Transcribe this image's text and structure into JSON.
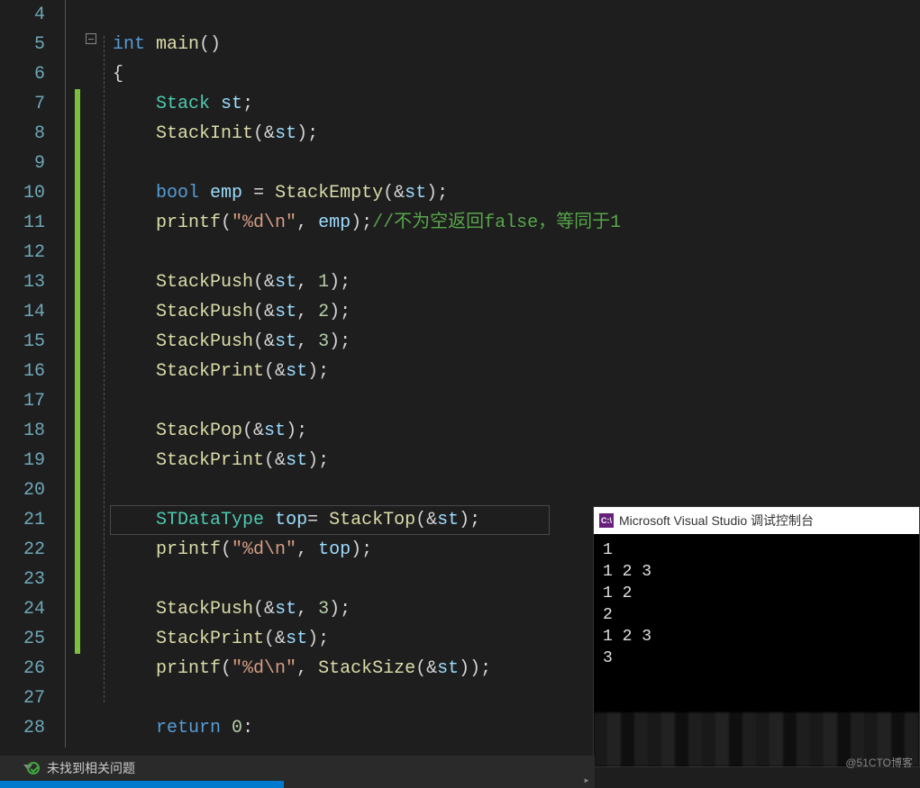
{
  "lines": {
    "start": 4,
    "end": 28,
    "code": [
      "",
      "int main()",
      "{",
      "    Stack st;",
      "    StackInit(&st);",
      "",
      "    bool emp = StackEmpty(&st);",
      "    printf(\"%d\\n\", emp);//不为空返回false，等同于1",
      "",
      "    StackPush(&st, 1);",
      "    StackPush(&st, 2);",
      "    StackPush(&st, 3);",
      "    StackPrint(&st);",
      "",
      "    StackPop(&st);",
      "    StackPrint(&st);",
      "",
      "    STDataType top= StackTop(&st);",
      "    printf(\"%d\\n\", top);",
      "",
      "    StackPush(&st, 3);",
      "    StackPrint(&st);",
      "    printf(\"%d\\n\", StackSize(&st));",
      "",
      "    return 0:"
    ],
    "tokens": {
      "l5": [
        {
          "c": "kw",
          "t": "int"
        },
        {
          "c": "plain",
          "t": " "
        },
        {
          "c": "fn",
          "t": "main"
        },
        {
          "c": "pun",
          "t": "()"
        }
      ],
      "l6": [
        {
          "c": "pun",
          "t": "{"
        }
      ],
      "l7": [
        {
          "c": "plain",
          "t": "    "
        },
        {
          "c": "type",
          "t": "Stack"
        },
        {
          "c": "plain",
          "t": " "
        },
        {
          "c": "id",
          "t": "st"
        },
        {
          "c": "pun",
          "t": ";"
        }
      ],
      "l8": [
        {
          "c": "plain",
          "t": "    "
        },
        {
          "c": "fn",
          "t": "StackInit"
        },
        {
          "c": "pun",
          "t": "(&"
        },
        {
          "c": "id",
          "t": "st"
        },
        {
          "c": "pun",
          "t": ");"
        }
      ],
      "l10": [
        {
          "c": "plain",
          "t": "    "
        },
        {
          "c": "kw",
          "t": "bool"
        },
        {
          "c": "plain",
          "t": " "
        },
        {
          "c": "id",
          "t": "emp"
        },
        {
          "c": "plain",
          "t": " "
        },
        {
          "c": "pun",
          "t": "="
        },
        {
          "c": "plain",
          "t": " "
        },
        {
          "c": "fn",
          "t": "StackEmpty"
        },
        {
          "c": "pun",
          "t": "(&"
        },
        {
          "c": "id",
          "t": "st"
        },
        {
          "c": "pun",
          "t": ");"
        }
      ],
      "l11": [
        {
          "c": "plain",
          "t": "    "
        },
        {
          "c": "fn",
          "t": "printf"
        },
        {
          "c": "pun",
          "t": "("
        },
        {
          "c": "str",
          "t": "\"%d\\n\""
        },
        {
          "c": "pun",
          "t": ", "
        },
        {
          "c": "id",
          "t": "emp"
        },
        {
          "c": "pun",
          "t": ");"
        },
        {
          "c": "cmt",
          "t": "//不为空返回false，等同于1"
        }
      ],
      "l13": [
        {
          "c": "plain",
          "t": "    "
        },
        {
          "c": "fn",
          "t": "StackPush"
        },
        {
          "c": "pun",
          "t": "(&"
        },
        {
          "c": "id",
          "t": "st"
        },
        {
          "c": "pun",
          "t": ", "
        },
        {
          "c": "num",
          "t": "1"
        },
        {
          "c": "pun",
          "t": ");"
        }
      ],
      "l14": [
        {
          "c": "plain",
          "t": "    "
        },
        {
          "c": "fn",
          "t": "StackPush"
        },
        {
          "c": "pun",
          "t": "(&"
        },
        {
          "c": "id",
          "t": "st"
        },
        {
          "c": "pun",
          "t": ", "
        },
        {
          "c": "num",
          "t": "2"
        },
        {
          "c": "pun",
          "t": ");"
        }
      ],
      "l15": [
        {
          "c": "plain",
          "t": "    "
        },
        {
          "c": "fn",
          "t": "StackPush"
        },
        {
          "c": "pun",
          "t": "(&"
        },
        {
          "c": "id",
          "t": "st"
        },
        {
          "c": "pun",
          "t": ", "
        },
        {
          "c": "num",
          "t": "3"
        },
        {
          "c": "pun",
          "t": ");"
        }
      ],
      "l16": [
        {
          "c": "plain",
          "t": "    "
        },
        {
          "c": "fn",
          "t": "StackPrint"
        },
        {
          "c": "pun",
          "t": "(&"
        },
        {
          "c": "id",
          "t": "st"
        },
        {
          "c": "pun",
          "t": ");"
        }
      ],
      "l18": [
        {
          "c": "plain",
          "t": "    "
        },
        {
          "c": "fn",
          "t": "StackPop"
        },
        {
          "c": "pun",
          "t": "(&"
        },
        {
          "c": "id",
          "t": "st"
        },
        {
          "c": "pun",
          "t": ");"
        }
      ],
      "l19": [
        {
          "c": "plain",
          "t": "    "
        },
        {
          "c": "fn",
          "t": "StackPrint"
        },
        {
          "c": "pun",
          "t": "(&"
        },
        {
          "c": "id",
          "t": "st"
        },
        {
          "c": "pun",
          "t": ");"
        }
      ],
      "l21": [
        {
          "c": "plain",
          "t": "    "
        },
        {
          "c": "type",
          "t": "STDataType"
        },
        {
          "c": "plain",
          "t": " "
        },
        {
          "c": "id",
          "t": "top"
        },
        {
          "c": "pun",
          "t": "= "
        },
        {
          "c": "fn",
          "t": "StackTop"
        },
        {
          "c": "pun",
          "t": "(&"
        },
        {
          "c": "id",
          "t": "st"
        },
        {
          "c": "pun",
          "t": ");"
        }
      ],
      "l22": [
        {
          "c": "plain",
          "t": "    "
        },
        {
          "c": "fn",
          "t": "printf"
        },
        {
          "c": "pun",
          "t": "("
        },
        {
          "c": "str",
          "t": "\"%d\\n\""
        },
        {
          "c": "pun",
          "t": ", "
        },
        {
          "c": "id",
          "t": "top"
        },
        {
          "c": "pun",
          "t": ");"
        }
      ],
      "l24": [
        {
          "c": "plain",
          "t": "    "
        },
        {
          "c": "fn",
          "t": "StackPush"
        },
        {
          "c": "pun",
          "t": "(&"
        },
        {
          "c": "id",
          "t": "st"
        },
        {
          "c": "pun",
          "t": ", "
        },
        {
          "c": "num",
          "t": "3"
        },
        {
          "c": "pun",
          "t": ");"
        }
      ],
      "l25": [
        {
          "c": "plain",
          "t": "    "
        },
        {
          "c": "fn",
          "t": "StackPrint"
        },
        {
          "c": "pun",
          "t": "(&"
        },
        {
          "c": "id",
          "t": "st"
        },
        {
          "c": "pun",
          "t": ");"
        }
      ],
      "l26": [
        {
          "c": "plain",
          "t": "    "
        },
        {
          "c": "fn",
          "t": "printf"
        },
        {
          "c": "pun",
          "t": "("
        },
        {
          "c": "str",
          "t": "\"%d\\n\""
        },
        {
          "c": "pun",
          "t": ", "
        },
        {
          "c": "fn",
          "t": "StackSize"
        },
        {
          "c": "pun",
          "t": "(&"
        },
        {
          "c": "id",
          "t": "st"
        },
        {
          "c": "pun",
          "t": "));"
        }
      ],
      "l28": [
        {
          "c": "plain",
          "t": "    "
        },
        {
          "c": "kw",
          "t": "return"
        },
        {
          "c": "plain",
          "t": " "
        },
        {
          "c": "num",
          "t": "0"
        },
        {
          "c": "pun",
          "t": ":"
        }
      ]
    }
  },
  "console": {
    "title": "Microsoft Visual Studio 调试控制台",
    "icon_text": "C:\\",
    "output": [
      "1",
      "1 2 3",
      "1 2",
      "2",
      "1 2 3",
      "3"
    ]
  },
  "status": {
    "text": "未找到相关问题"
  },
  "watermark": "@51CTO博客"
}
